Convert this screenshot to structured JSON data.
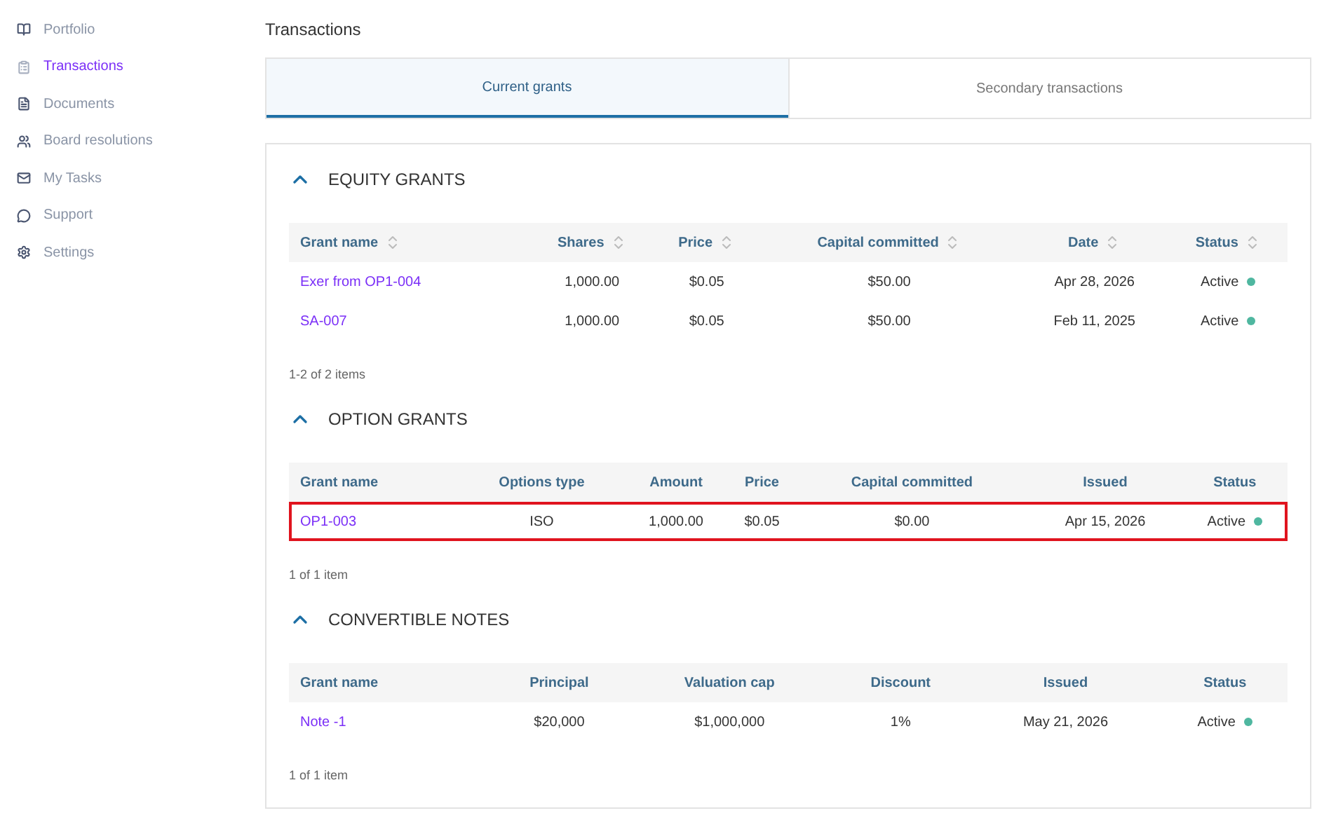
{
  "sidebar": {
    "items": [
      {
        "label": "Portfolio",
        "selected": false
      },
      {
        "label": "Transactions",
        "selected": true
      },
      {
        "label": "Documents",
        "selected": false
      },
      {
        "label": "Board resolutions",
        "selected": false
      },
      {
        "label": "My Tasks",
        "selected": false
      },
      {
        "label": "Support",
        "selected": false
      },
      {
        "label": "Settings",
        "selected": false
      }
    ]
  },
  "page_title": "Transactions",
  "tabs": [
    {
      "label": "Current grants",
      "selected": true
    },
    {
      "label": "Secondary transactions",
      "selected": false
    }
  ],
  "sections": [
    {
      "title": "EQUITY GRANTS",
      "expanded": true,
      "columns": [
        {
          "label": "Grant name",
          "sortable": true
        },
        {
          "label": "Shares",
          "sortable": true
        },
        {
          "label": "Price",
          "sortable": true
        },
        {
          "label": "Capital committed",
          "sortable": true
        },
        {
          "label": "Date",
          "sortable": true
        },
        {
          "label": "Status",
          "sortable": true
        }
      ],
      "rows": [
        {
          "highlighted": false,
          "cells": [
            "Exer from OP1-004",
            "1,000.00",
            "$0.05",
            "$50.00",
            "Apr 28, 2026"
          ],
          "status": "Active",
          "color": "#4fb7a0"
        },
        {
          "highlighted": false,
          "cells": [
            "SA-007",
            "1,000.00",
            "$0.05",
            "$50.00",
            "Feb 11, 2025"
          ],
          "status": "Active",
          "color": "#4fb7a0"
        }
      ],
      "footer": "1-2 of 2 items"
    },
    {
      "title": "OPTION GRANTS",
      "expanded": true,
      "columns": [
        {
          "label": "Grant name",
          "sortable": false
        },
        {
          "label": "Options type",
          "sortable": false
        },
        {
          "label": "Amount",
          "sortable": false
        },
        {
          "label": "Price",
          "sortable": false
        },
        {
          "label": "Capital committed",
          "sortable": false
        },
        {
          "label": "Issued",
          "sortable": false
        },
        {
          "label": "Status",
          "sortable": false
        }
      ],
      "rows": [
        {
          "highlighted": true,
          "cells": [
            "OP1-003",
            "ISO",
            "1,000.00",
            "$0.05",
            "$0.00",
            "Apr 15, 2026"
          ],
          "status": "Active",
          "color": "#4fb7a0"
        }
      ],
      "footer": "1 of 1 item"
    },
    {
      "title": "CONVERTIBLE NOTES",
      "expanded": true,
      "columns": [
        {
          "label": "Grant name",
          "sortable": false
        },
        {
          "label": "Principal",
          "sortable": false
        },
        {
          "label": "Valuation cap",
          "sortable": false
        },
        {
          "label": "Discount",
          "sortable": false
        },
        {
          "label": "Issued",
          "sortable": false
        },
        {
          "label": "Status",
          "sortable": false
        }
      ],
      "rows": [
        {
          "highlighted": false,
          "cells": [
            "Note -1",
            "$20,000",
            "$1,000,000",
            "1%",
            "May 21, 2026"
          ],
          "status": "Active",
          "color": "#4fb7a0"
        }
      ],
      "footer": "1 of 1 item"
    }
  ]
}
